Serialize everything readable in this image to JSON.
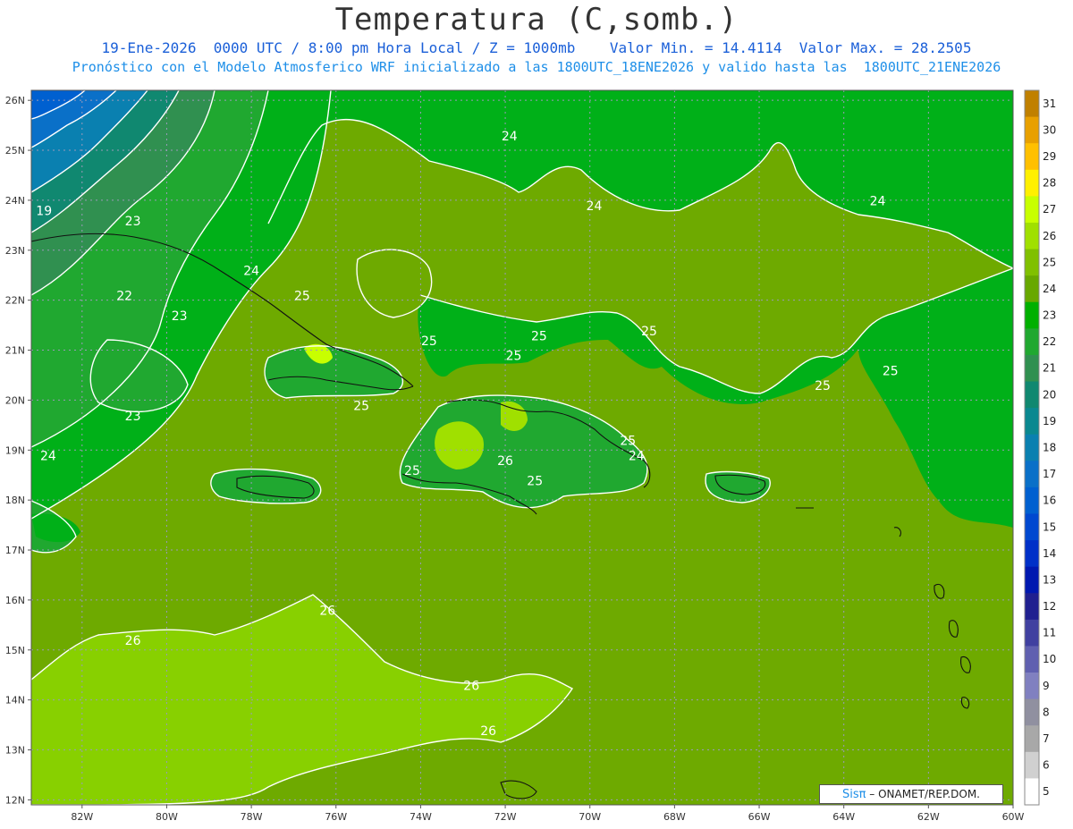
{
  "header": {
    "title": "Temperatura (C,somb.)",
    "subtitle1": "19-Ene-2026  0000 UTC / 8:00 pm Hora Local / Z = 1000mb    Valor Min. = 14.4114  Valor Max. = 28.2505",
    "subtitle2": "Pronóstico con el Modelo Atmosferico WRF inicializado a las 1800UTC_18ENE2026 y valido hasta las  1800UTC_21ENE2026"
  },
  "axes": {
    "lat_labels": [
      "26N",
      "25N",
      "24N",
      "23N",
      "22N",
      "21N",
      "20N",
      "19N",
      "18N",
      "17N",
      "16N",
      "15N",
      "14N",
      "13N",
      "12N"
    ],
    "lon_labels": [
      "82W",
      "80W",
      "78W",
      "76W",
      "74W",
      "72W",
      "70W",
      "68W",
      "66W",
      "64W",
      "62W",
      "60W"
    ]
  },
  "contour_labels": [
    {
      "text": "24",
      "lon": -71.9,
      "lat": 25.2
    },
    {
      "text": "24",
      "lon": -69.9,
      "lat": 23.8
    },
    {
      "text": "24",
      "lon": -63.2,
      "lat": 23.9
    },
    {
      "text": "19",
      "lon": -82.9,
      "lat": 23.7
    },
    {
      "text": "23",
      "lon": -80.8,
      "lat": 23.5
    },
    {
      "text": "24",
      "lon": -78.0,
      "lat": 22.5
    },
    {
      "text": "25",
      "lon": -76.8,
      "lat": 22.0
    },
    {
      "text": "22",
      "lon": -81.0,
      "lat": 22.0
    },
    {
      "text": "23",
      "lon": -79.7,
      "lat": 21.6
    },
    {
      "text": "25",
      "lon": -73.8,
      "lat": 21.1
    },
    {
      "text": "25",
      "lon": -71.2,
      "lat": 21.2
    },
    {
      "text": "25",
      "lon": -68.6,
      "lat": 21.3
    },
    {
      "text": "25",
      "lon": -71.8,
      "lat": 20.8
    },
    {
      "text": "25",
      "lon": -62.9,
      "lat": 20.5
    },
    {
      "text": "25",
      "lon": -64.5,
      "lat": 20.2
    },
    {
      "text": "25",
      "lon": -75.4,
      "lat": 19.8
    },
    {
      "text": "23",
      "lon": -80.8,
      "lat": 19.6
    },
    {
      "text": "24",
      "lon": -82.8,
      "lat": 18.8
    },
    {
      "text": "25",
      "lon": -69.1,
      "lat": 19.1
    },
    {
      "text": "24",
      "lon": -68.9,
      "lat": 18.8
    },
    {
      "text": "26",
      "lon": -72.0,
      "lat": 18.7
    },
    {
      "text": "25",
      "lon": -74.2,
      "lat": 18.5
    },
    {
      "text": "25",
      "lon": -71.3,
      "lat": 18.3
    },
    {
      "text": "26",
      "lon": -76.2,
      "lat": 15.7
    },
    {
      "text": "26",
      "lon": -80.8,
      "lat": 15.1
    },
    {
      "text": "26",
      "lon": -72.8,
      "lat": 14.2
    },
    {
      "text": "26",
      "lon": -72.4,
      "lat": 13.3
    }
  ],
  "colorbar": {
    "labels": [
      "31",
      "30",
      "29",
      "28",
      "27",
      "26",
      "25",
      "24",
      "23",
      "22",
      "21",
      "20",
      "19",
      "18",
      "17",
      "16",
      "15",
      "14",
      "13",
      "12",
      "11",
      "10",
      "9",
      "8",
      "7",
      "6",
      "5"
    ],
    "colors": [
      "#c08000",
      "#e8a000",
      "#ffc000",
      "#fff000",
      "#c8ff00",
      "#a0e000",
      "#80c000",
      "#68a800",
      "#00b000",
      "#20a830",
      "#309050",
      "#108870",
      "#0a8890",
      "#0a80b0",
      "#0a70c8",
      "#0060d0",
      "#0048d0",
      "#0030c8",
      "#0018b0",
      "#202090",
      "#4040a0",
      "#6060b0",
      "#8080c0",
      "#9090a0",
      "#a8a8a8",
      "#d0d0d0",
      "#ffffff"
    ]
  },
  "credit": {
    "sis": "Sisπ",
    "text": " – ONAMET/REP.DOM."
  }
}
